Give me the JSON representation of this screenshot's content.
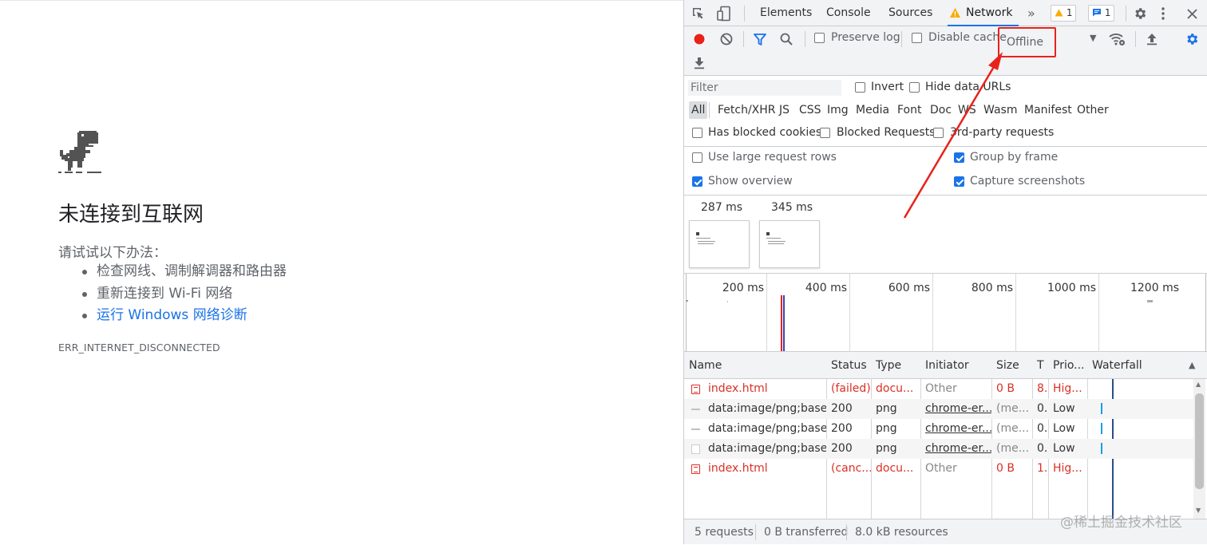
{
  "offline_page": {
    "title": "未连接到互联网",
    "suggestions_heading": "请试试以下办法：",
    "suggestions": [
      "检查网线、调制解调器和路由器",
      "重新连接到 Wi-Fi 网络",
      "运行 Windows 网络诊断"
    ],
    "error_code": "ERR_INTERNET_DISCONNECTED"
  },
  "devtools": {
    "tabs": [
      {
        "label": "Elements"
      },
      {
        "label": "Console"
      },
      {
        "label": "Sources"
      },
      {
        "label": "Network",
        "active": true
      }
    ],
    "more_tabs": "»",
    "warning_count": "1",
    "message_count": "1",
    "toolbar": {
      "preserve_log": "Preserve log",
      "disable_cache": "Disable cache",
      "throttling": "Offline"
    },
    "filter": {
      "placeholder": "Filter",
      "invert": "Invert",
      "hide_data_urls": "Hide data URLs",
      "types": [
        "All",
        "Fetch/XHR",
        "JS",
        "CSS",
        "Img",
        "Media",
        "Font",
        "Doc",
        "WS",
        "Wasm",
        "Manifest",
        "Other"
      ],
      "has_blocked_cookies": "Has blocked cookies",
      "blocked_requests": "Blocked Requests",
      "third_party": "3rd-party requests"
    },
    "settings": {
      "large_rows": "Use large request rows",
      "group_by_frame": "Group by frame",
      "show_overview": "Show overview",
      "capture_screenshots": "Capture screenshots"
    },
    "screenshots": [
      {
        "time": "287 ms"
      },
      {
        "time": "345 ms"
      }
    ],
    "timeline_ticks": [
      "200 ms",
      "400 ms",
      "600 ms",
      "800 ms",
      "1000 ms",
      "1200 ms"
    ],
    "columns": [
      "Name",
      "Status",
      "Type",
      "Initiator",
      "Size",
      "T",
      "Prio...",
      "Waterfall"
    ],
    "rows": [
      {
        "name": "index.html",
        "status": "(failed)",
        "type": "docu...",
        "initiator": "Other",
        "size": "0 B",
        "time": "8...",
        "priority": "Hig...",
        "error": true,
        "icon": "doc"
      },
      {
        "name": "data:image/png;base...",
        "status": "200",
        "type": "png",
        "initiator": "chrome-er...",
        "size": "(me...",
        "time": "0...",
        "priority": "Low",
        "error": false,
        "icon": "img"
      },
      {
        "name": "data:image/png;base...",
        "status": "200",
        "type": "png",
        "initiator": "chrome-er...",
        "size": "(me...",
        "time": "0...",
        "priority": "Low",
        "error": false,
        "icon": "img"
      },
      {
        "name": "data:image/png;base...",
        "status": "200",
        "type": "png",
        "initiator": "chrome-er...",
        "size": "(me...",
        "time": "0...",
        "priority": "Low",
        "error": false,
        "icon": "chk"
      },
      {
        "name": "index.html",
        "status": "(canc...",
        "type": "docu...",
        "initiator": "Other",
        "size": "0 B",
        "time": "1...",
        "priority": "Hig...",
        "error": true,
        "icon": "doc"
      }
    ],
    "status_bar": {
      "requests": "5 requests",
      "transferred": "0 B transferred",
      "resources": "8.0 kB resources"
    }
  },
  "watermark": "@稀土掘金技术社区",
  "colors": {
    "accent": "#1a73e8",
    "error": "#d93025",
    "highlight": "#e8221b"
  }
}
